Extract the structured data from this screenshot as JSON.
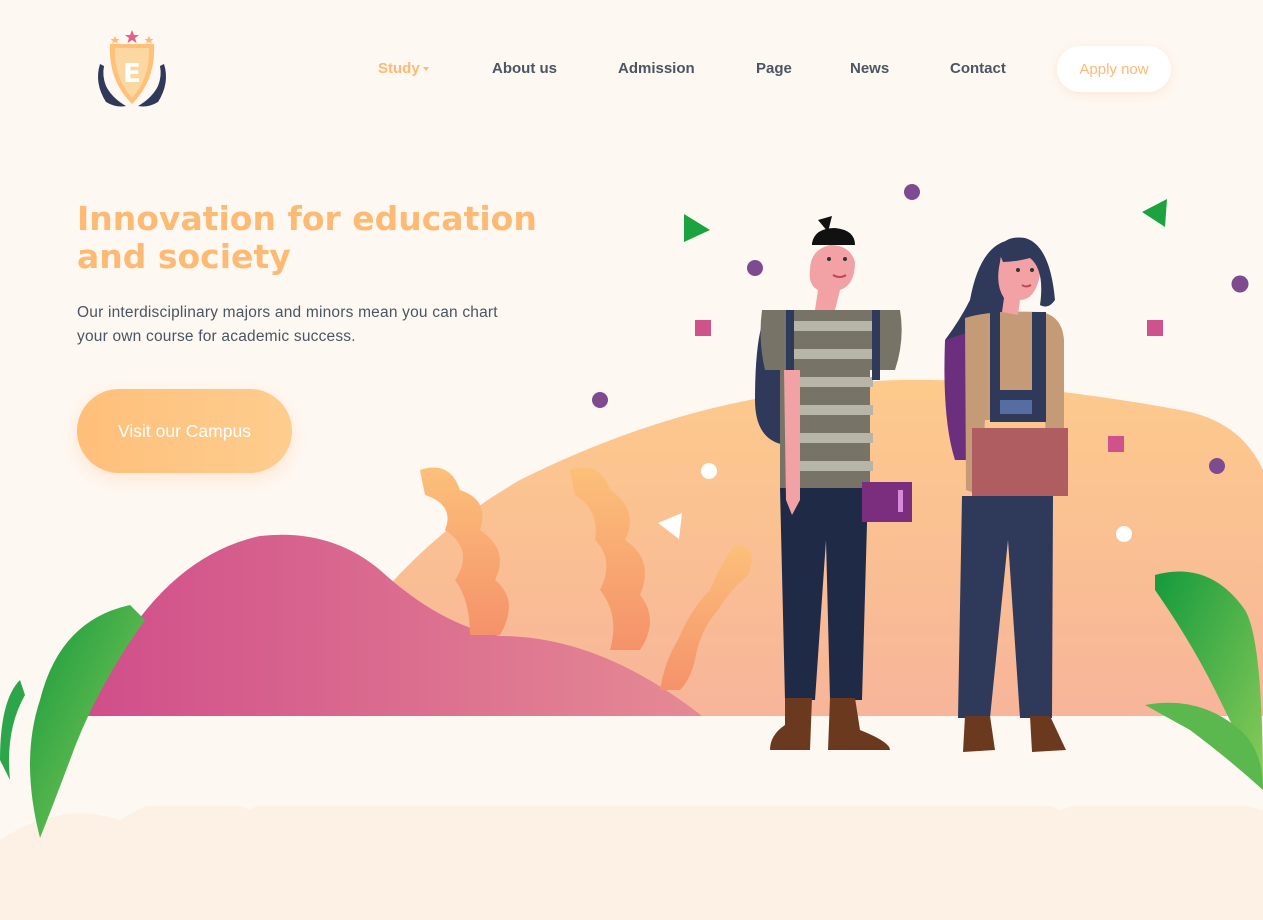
{
  "logo": {
    "letter": "E"
  },
  "nav": {
    "items": [
      {
        "label": "Study"
      },
      {
        "label": "About us"
      },
      {
        "label": "Admission"
      },
      {
        "label": "Page"
      },
      {
        "label": "News"
      },
      {
        "label": "Contact"
      }
    ],
    "apply_label": "Apply now"
  },
  "hero": {
    "title": "Innovation for education and society",
    "subtitle": "Our interdisciplinary majors and minors mean you can chart your own course for academic success.",
    "cta_label": "Visit our Campus"
  },
  "colors": {
    "accent": "#fdba74",
    "text": "#4b5563",
    "background": "#fef8f2"
  }
}
